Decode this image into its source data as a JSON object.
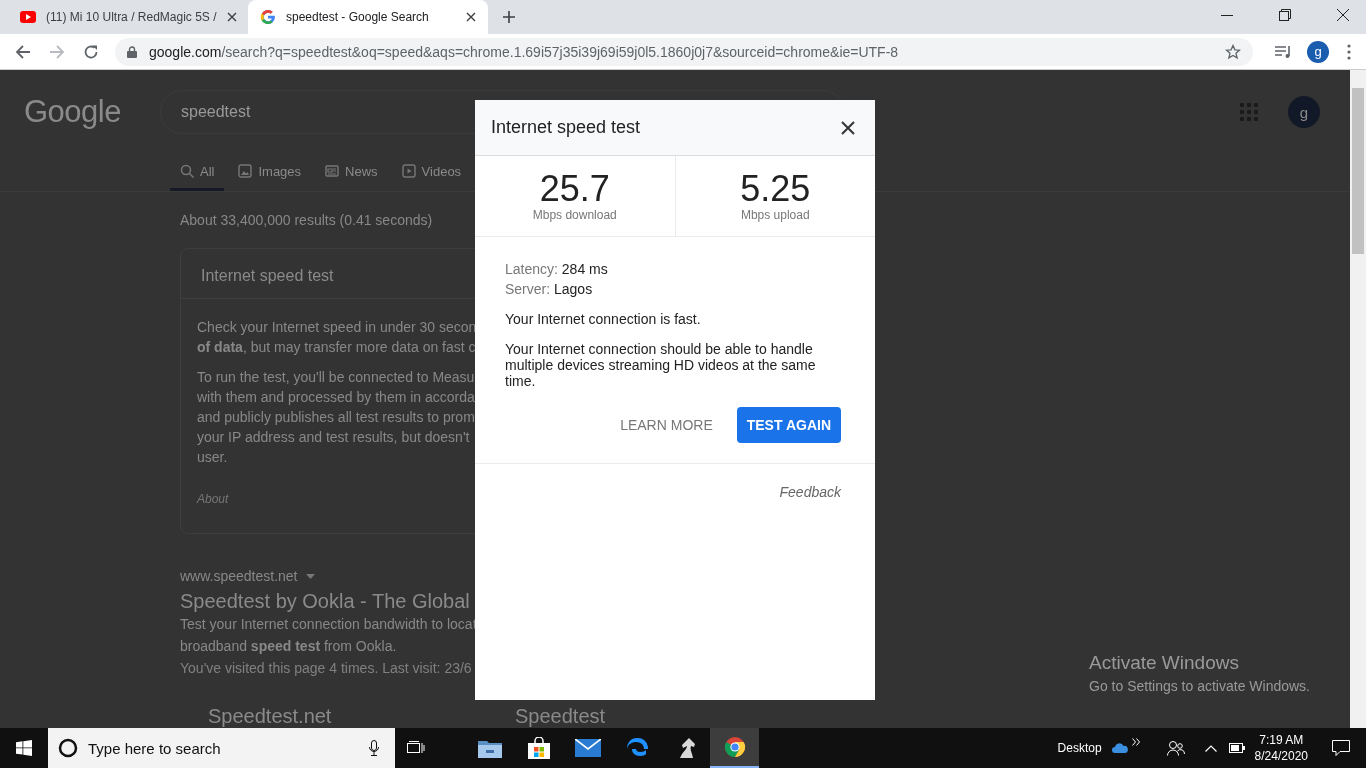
{
  "browser": {
    "tabs": [
      {
        "kind": "video",
        "title": "(11) Mi 10 Ultra / RedMagic 5S /",
        "selected": false
      },
      {
        "kind": "search",
        "title": "speedtest - Google Search",
        "selected": true
      }
    ],
    "toolbar": {
      "back_disabled": false,
      "forward_disabled": true,
      "url_domain": "google.com",
      "url_path": "/search?q=speedtest&oq=speed&aqs=chrome.1.69i57j35i39j69i59j0l5.1860j0j7&sourceid=chrome&ie=UTF-8",
      "profile_initial": "g"
    }
  },
  "page": {
    "logo": "Google",
    "query": "speedtest",
    "account_initial": "g",
    "tabs": [
      {
        "kind": "search",
        "label": "All",
        "selected": true
      },
      {
        "kind": "images",
        "label": "Images",
        "selected": false
      },
      {
        "kind": "news",
        "label": "News",
        "selected": false
      },
      {
        "kind": "videos",
        "label": "Videos",
        "selected": false
      }
    ],
    "result_stats": "About 33,400,000 results (0.41 seconds)",
    "answer_card": {
      "title": "Internet speed test",
      "paragraphs": [
        [
          "Check your Internet speed in under 30 secon",
          "**of data**, but may transfer more data on fast c"
        ],
        [
          "To run the test, you'll be connected to Measu",
          "with them and processed by them in accorda",
          "and publicly publishes all test results to prom",
          "your IP address and test results, but doesn't",
          "user."
        ]
      ],
      "about": "About"
    },
    "result": {
      "url": "www.speedtest.net",
      "title": "Speedtest by Ookla - The Global",
      "snippet": [
        "Test your Internet connection bandwidth to locat",
        "broadband **speed test** from Ookla."
      ],
      "visited": "You've visited this page 4 times. Last visit: 23/6",
      "sitelinks": [
        "Speedtest.net",
        "Speedtest"
      ]
    }
  },
  "dialog": {
    "title": "Internet speed test",
    "results": [
      {
        "value": "25.7",
        "label": "Mbps download"
      },
      {
        "value": "5.25",
        "label": "Mbps upload"
      }
    ],
    "details": [
      {
        "label": "Latency:",
        "value": "284 ms"
      },
      {
        "label": "Server:",
        "value": "Lagos"
      }
    ],
    "verdict": "Your Internet connection is fast.",
    "description": "Your Internet connection should be able to handle multiple devices streaming HD videos at the same time.",
    "buttons": [
      {
        "kind": "text",
        "label": "LEARN MORE"
      },
      {
        "kind": "primary",
        "label": "TEST AGAIN"
      }
    ],
    "feedback": "Feedback"
  },
  "activation_notice": {
    "title": "Activate Windows",
    "text": "Go to Settings to activate Windows."
  },
  "taskbar": {
    "search_placeholder": "Type here to search",
    "apps": [
      {
        "kind": "explorer",
        "active": false
      },
      {
        "kind": "store",
        "active": false
      },
      {
        "kind": "mail",
        "active": false
      },
      {
        "kind": "edge",
        "active": false
      },
      {
        "kind": "chess",
        "active": false
      },
      {
        "kind": "chrome",
        "active": true
      }
    ],
    "tray": {
      "desktop_label": "Desktop",
      "time": "7:19 AM",
      "date": "8/24/2020"
    }
  }
}
